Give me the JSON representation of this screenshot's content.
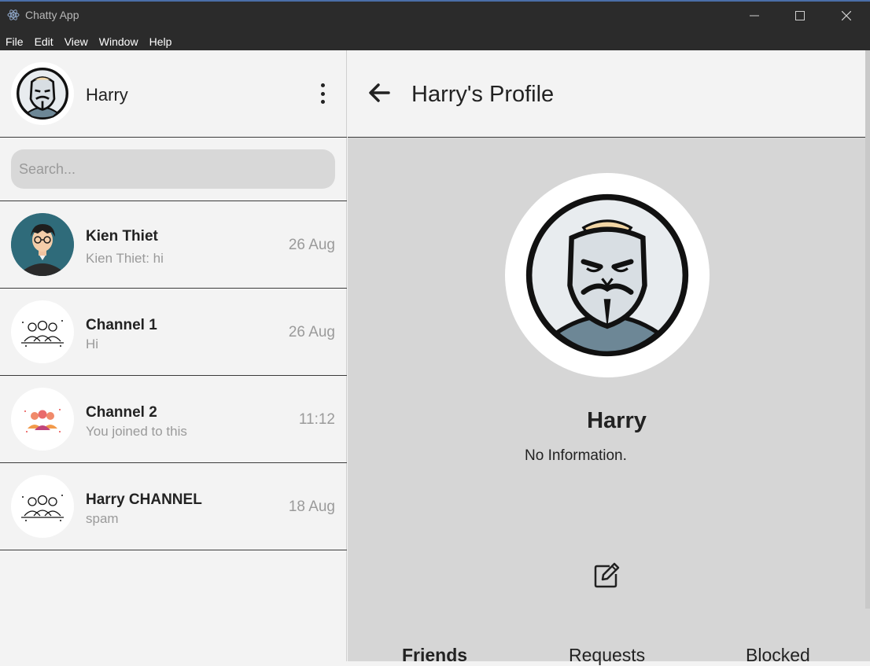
{
  "window": {
    "title": "Chatty App",
    "menu": [
      "File",
      "Edit",
      "View",
      "Window",
      "Help"
    ]
  },
  "sidebar": {
    "user": {
      "name": "Harry"
    },
    "search": {
      "placeholder": "Search..."
    },
    "conversations": [
      {
        "name": "Kien Thiet",
        "preview": "Kien Thiet: hi",
        "time": "26 Aug"
      },
      {
        "name": "Channel 1",
        "preview": "Hi",
        "time": "26 Aug"
      },
      {
        "name": "Channel 2",
        "preview": "You joined to this",
        "time": "11:12"
      },
      {
        "name": "Harry CHANNEL",
        "preview": "spam",
        "time": "18 Aug"
      }
    ]
  },
  "main": {
    "title": "Harry's Profile",
    "profile": {
      "name": "Harry",
      "info": "No Information."
    },
    "tabs": [
      "Friends",
      "Requests",
      "Blocked"
    ]
  },
  "colors": {
    "titlebar": "#2b2b2b",
    "sidebar_bg": "#f3f3f3",
    "main_bg": "#d6d6d6",
    "search_bg": "#d8d8d8",
    "muted_text": "#9a9a9a"
  }
}
